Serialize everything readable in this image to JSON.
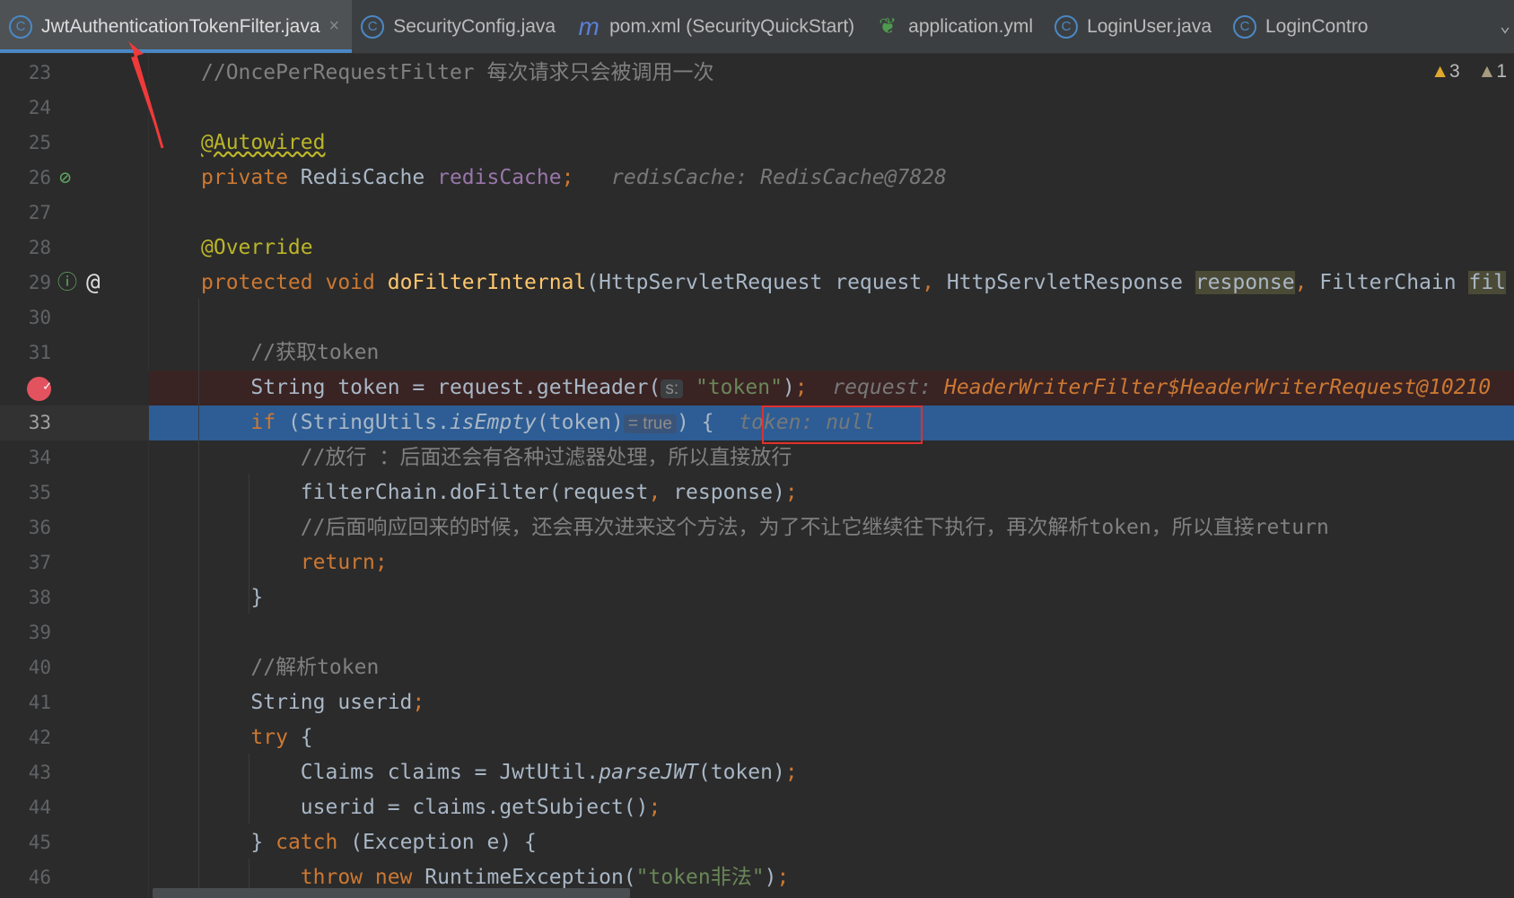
{
  "tabs": [
    {
      "label": "JwtAuthenticationTokenFilter.java",
      "icon": "class-icon",
      "glyph": "C",
      "active": true,
      "closable": true
    },
    {
      "label": "SecurityConfig.java",
      "icon": "class-icon",
      "glyph": "C"
    },
    {
      "label": "pom.xml (SecurityQuickStart)",
      "icon": "maven-icon",
      "glyph": "m"
    },
    {
      "label": "application.yml",
      "icon": "spring-yaml-icon",
      "glyph": "❦"
    },
    {
      "label": "LoginUser.java",
      "icon": "class-icon",
      "glyph": "C"
    },
    {
      "label": "LoginContro",
      "icon": "class-icon",
      "glyph": "C"
    }
  ],
  "close_glyph": "×",
  "more_glyph": "⌄",
  "inspections": {
    "warnings": "3",
    "weak_warnings": "1",
    "warning_icon": "warning-triangle-icon"
  },
  "colors": {
    "background": "#2B2B2B",
    "current_line": "#2D5D94",
    "breakpoint_line": "#3A2323",
    "keyword": "#CC7832",
    "annotation": "#BBB529",
    "string": "#6A8759",
    "comment": "#808080"
  },
  "lines": [
    {
      "n": "23",
      "tokens": [
        [
          "cm",
          "//OncePerRequestFilter 每次请求只会被调用一次"
        ]
      ]
    },
    {
      "n": "24",
      "tokens": []
    },
    {
      "n": "25",
      "tokens": [
        [
          "an squig",
          "@Autowired"
        ]
      ]
    },
    {
      "n": "26",
      "gutter_icon": "autowired-bean-icon",
      "tokens": [
        [
          "kw",
          "private "
        ],
        [
          "",
          "RedisCache "
        ],
        [
          "fd",
          "redisCache"
        ],
        [
          "kw",
          ";"
        ],
        [
          "hint",
          "   redisCache: RedisCache@7828"
        ]
      ]
    },
    {
      "n": "27",
      "tokens": []
    },
    {
      "n": "28",
      "tokens": [
        [
          "an",
          "@Override"
        ]
      ]
    },
    {
      "n": "29",
      "gutter_icon": "overrides-method-icon",
      "tokens": [
        [
          "kw",
          "protected void "
        ],
        [
          "md",
          "doFilterInternal"
        ],
        [
          "",
          "(HttpServletRequest request"
        ],
        [
          "kw",
          ", "
        ],
        [
          "",
          "HttpServletResponse "
        ],
        [
          "hl",
          "response"
        ],
        [
          "kw",
          ", "
        ],
        [
          "",
          "FilterChain "
        ],
        [
          "hl",
          "fil"
        ]
      ]
    },
    {
      "n": "30",
      "tokens": []
    },
    {
      "n": "31",
      "tokens": [
        [
          "cm",
          "    //获取token"
        ]
      ]
    },
    {
      "n": "32",
      "breakpoint": true,
      "tokens": [
        [
          "",
          "    String token = request.getHeader("
        ],
        [
          "ph",
          "s:"
        ],
        [
          "st",
          " \"token\""
        ],
        [
          "",
          ")"
        ],
        [
          "kw",
          ";"
        ],
        [
          "hint",
          "  request: "
        ],
        [
          "dv",
          "HeaderWriterFilter$HeaderWriterRequest@10210"
        ]
      ]
    },
    {
      "n": "33",
      "current": true,
      "tokens": [
        [
          "kw",
          "    if "
        ],
        [
          "",
          "(StringUtils."
        ],
        [
          "it",
          "isEmpty"
        ],
        [
          "",
          "(token)"
        ],
        [
          "ph",
          "= true"
        ],
        [
          "",
          ") {  "
        ],
        [
          "hint",
          "token: null"
        ]
      ]
    },
    {
      "n": "34",
      "tokens": [
        [
          "cm",
          "        //放行 ：后面还会有各种过滤器处理，所以直接放行"
        ]
      ]
    },
    {
      "n": "35",
      "tokens": [
        [
          "",
          "        filterChain.doFilter(request"
        ],
        [
          "kw",
          ", "
        ],
        [
          "",
          "response)"
        ],
        [
          "kw",
          ";"
        ]
      ]
    },
    {
      "n": "36",
      "tokens": [
        [
          "cm",
          "        //后面响应回来的时候，还会再次进来这个方法，为了不让它继续往下执行，再次解析token，所以直接return"
        ]
      ]
    },
    {
      "n": "37",
      "tokens": [
        [
          "kw",
          "        return;"
        ]
      ]
    },
    {
      "n": "38",
      "tokens": [
        [
          "",
          "    }"
        ]
      ]
    },
    {
      "n": "39",
      "tokens": []
    },
    {
      "n": "40",
      "tokens": [
        [
          "cm",
          "    //解析token"
        ]
      ]
    },
    {
      "n": "41",
      "tokens": [
        [
          "",
          "    String userid"
        ],
        [
          "kw",
          ";"
        ]
      ]
    },
    {
      "n": "42",
      "tokens": [
        [
          "kw",
          "    try "
        ],
        [
          "",
          "{"
        ]
      ]
    },
    {
      "n": "43",
      "tokens": [
        [
          "",
          "        Claims claims = JwtUtil."
        ],
        [
          "it",
          "parseJWT"
        ],
        [
          "",
          "(token)"
        ],
        [
          "kw",
          ";"
        ]
      ]
    },
    {
      "n": "44",
      "tokens": [
        [
          "",
          "        userid = claims.getSubject()"
        ],
        [
          "kw",
          ";"
        ]
      ]
    },
    {
      "n": "45",
      "tokens": [
        [
          "",
          "    } "
        ],
        [
          "kw",
          "catch "
        ],
        [
          "",
          "(Exception e) {"
        ]
      ]
    },
    {
      "n": "46",
      "tokens": [
        [
          "kw",
          "        throw new "
        ],
        [
          "",
          "RuntimeException("
        ],
        [
          "st",
          "\"token非法\""
        ],
        [
          "",
          ")"
        ],
        [
          "kw",
          ";"
        ]
      ]
    }
  ]
}
